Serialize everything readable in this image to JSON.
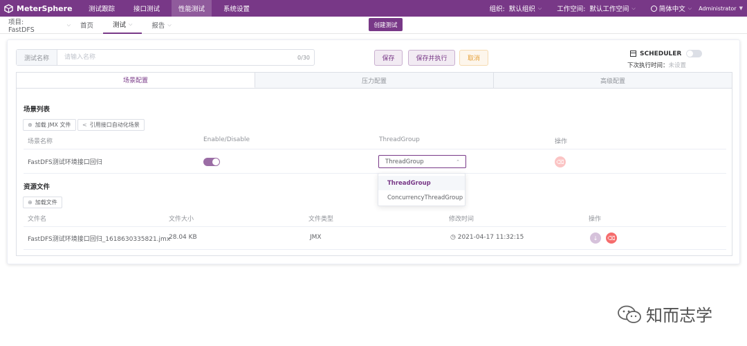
{
  "app": {
    "name": "MeterSphere"
  },
  "topnav": {
    "items": [
      "测试跟踪",
      "接口测试",
      "性能测试",
      "系统设置"
    ],
    "active_index": 2,
    "org_label": "组织:",
    "org_value": "默认组织",
    "workspace_label": "工作空间:",
    "workspace_value": "默认工作空间",
    "language": "简体中文",
    "user": "Administrator"
  },
  "subnav": {
    "project": "项目: FastDFS",
    "home": "首页",
    "test": "测试",
    "report": "报告",
    "create_button": "创建测试"
  },
  "form": {
    "name_label": "测试名称",
    "name_placeholder": "请输入名称",
    "name_count": "0/30",
    "save": "保存",
    "save_execute": "保存并执行",
    "cancel": "取消",
    "scheduler": "SCHEDULER",
    "next_run_label": "下次执行时间：",
    "next_run_value": "未设置"
  },
  "tabs": [
    "场景配置",
    "压力配置",
    "高级配置"
  ],
  "scenes": {
    "title": "场景列表",
    "load_jmx": "加载 JMX 文件",
    "reference": "引用接口自动化场景",
    "columns": [
      "场景名称",
      "Enable/Disable",
      "ThreadGroup",
      "操作"
    ],
    "rows": [
      {
        "name": "FastDFS测试环境接口回归",
        "enabled": true,
        "thread_group": "ThreadGroup"
      }
    ],
    "dropdown_options": [
      "ThreadGroup",
      "ConcurrencyThreadGroup"
    ]
  },
  "resources": {
    "title": "资源文件",
    "load_file": "加载文件",
    "columns": [
      "文件名",
      "文件大小",
      "文件类型",
      "修改时间",
      "操作"
    ],
    "rows": [
      {
        "name": "FastDFS测试环境接口回归_1618630335821.jmx",
        "size": "28.04 KB",
        "type": "JMX",
        "modified": "2021-04-17 11:32:15"
      }
    ]
  },
  "watermark": "知而志学",
  "colors": {
    "primary": "#783887",
    "danger": "#f56c6c",
    "warning": "#e6a23c"
  }
}
